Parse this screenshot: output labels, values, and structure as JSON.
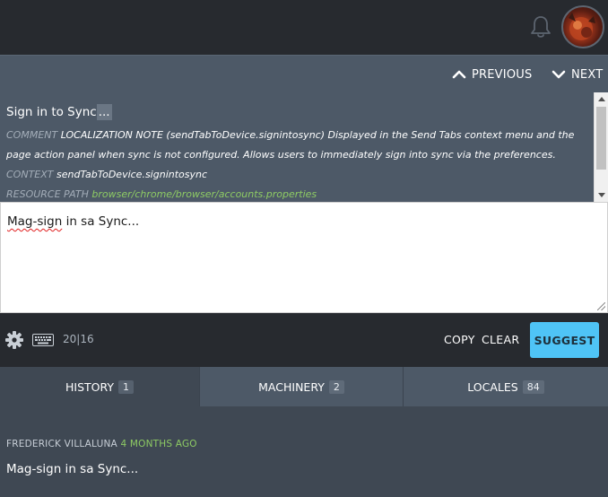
{
  "header": {
    "notifications_icon": "bell-icon",
    "avatar_icon": "user-avatar"
  },
  "navigation": {
    "previous_label": "PREVIOUS",
    "next_label": "NEXT"
  },
  "source": {
    "original_text": "Sign in to Sync",
    "original_ellipsis": "...",
    "comment_label": "COMMENT",
    "comment_text": "LOCALIZATION NOTE (sendTabToDevice.signintosync) Displayed in the Send Tabs context menu and the page action panel when sync is not configured. Allows users to immediately sign into sync via the preferences.",
    "context_label": "CONTEXT",
    "context_value": "sendTabToDevice.signintosync",
    "resource_path_label": "RESOURCE PATH",
    "resource_path_value": "browser/chrome/browser/accounts.properties"
  },
  "editor": {
    "translation_word_1": "Mag-sign",
    "translation_rest": " in sa Sync..."
  },
  "toolbar": {
    "settings_icon": "gear-icon",
    "keyboard_icon": "keyboard-icon",
    "character_count": "20|16",
    "copy_label": "COPY",
    "clear_label": "CLEAR",
    "suggest_label": "SUGGEST"
  },
  "tabs": [
    {
      "label": "HISTORY",
      "count": "1",
      "active": true
    },
    {
      "label": "MACHINERY",
      "count": "2",
      "active": false
    },
    {
      "label": "LOCALES",
      "count": "84",
      "active": false
    }
  ],
  "history": {
    "author": "FREDERICK VILLALUNA",
    "time": "4 MONTHS AGO",
    "translation": "Mag-sign in sa Sync..."
  },
  "colors": {
    "accent": "#4fc4f6",
    "path_green": "#8ecb64",
    "panel": "#4d5967",
    "dark": "#272a2f"
  }
}
